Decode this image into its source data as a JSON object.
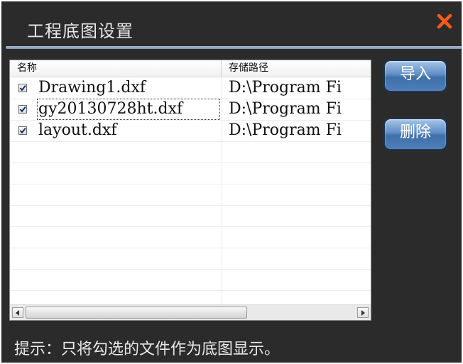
{
  "window": {
    "title": "工程底图设置",
    "close_icon": "close-icon",
    "accent_color": "#ff5a1a"
  },
  "list": {
    "columns": [
      "名称",
      "存储路径"
    ],
    "rows": [
      {
        "checked": true,
        "name": "Drawing1.dxf",
        "path": "D:\\Program Fi"
      },
      {
        "checked": true,
        "name": "gy20130728ht.dxf",
        "path": "D:\\Program Fi"
      },
      {
        "checked": true,
        "name": "layout.dxf",
        "path": "D:\\Program Fi"
      }
    ]
  },
  "buttons": {
    "import_label": "导入",
    "delete_label": "删除"
  },
  "hint": "提示：只将勾选的文件作为底图显示。"
}
